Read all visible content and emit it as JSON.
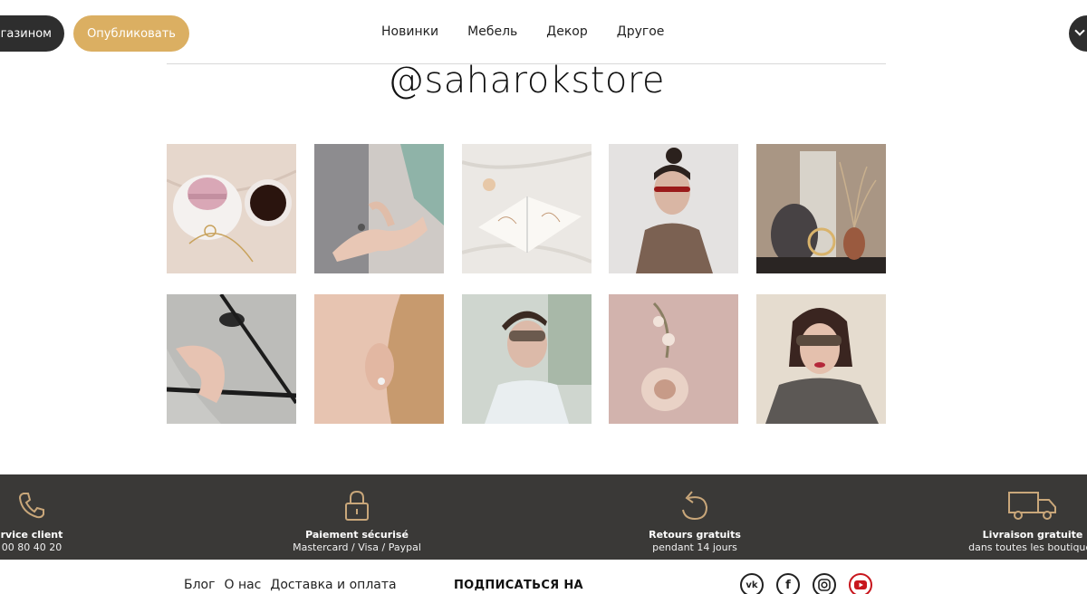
{
  "header": {
    "shop_button": "агазином",
    "publish_button": "Опубликовать",
    "nav": [
      "Новинки",
      "Мебель",
      "Декор",
      "Другое"
    ]
  },
  "handle": "@saharokstore",
  "gallery": {
    "photos": [
      "macaron-coffee-jewelry",
      "hand-ring-shadow",
      "open-book-sketch",
      "woman-red-sunglasses",
      "decor-vase-rings",
      "hand-on-horse",
      "ear-earring",
      "woman-glasses-window",
      "shell-orchid",
      "woman-glasses-portrait"
    ]
  },
  "services": [
    {
      "icon": "phone-icon",
      "title": "rvice client",
      "sub": "00 80 40 20"
    },
    {
      "icon": "lock-icon",
      "title": "Paiement sécurisé",
      "sub": "Mastercard / Visa / Paypal"
    },
    {
      "icon": "return-arrow-icon",
      "title": "Retours gratuits",
      "sub": "pendant 14 jours"
    },
    {
      "icon": "truck-icon",
      "title": "Livraison gratuite",
      "sub": "dans toutes les boutiques"
    }
  ],
  "footer": {
    "links": [
      "Блог",
      "О нас",
      "Доставка и оплата"
    ],
    "subscribe": "ПОДПИСАТЬСЯ НА",
    "socials": [
      {
        "icon": "vk-icon",
        "label": "vk"
      },
      {
        "icon": "facebook-icon",
        "label": "f"
      },
      {
        "icon": "instagram-icon",
        "label": ""
      },
      {
        "icon": "youtube-icon",
        "label": ""
      }
    ]
  },
  "colors": {
    "accent_gold": "#dbaf62",
    "dark": "#2e2e2e",
    "band": "#3a3937",
    "icon_gold": "#c9a77a",
    "youtube_red": "#c8161d"
  }
}
